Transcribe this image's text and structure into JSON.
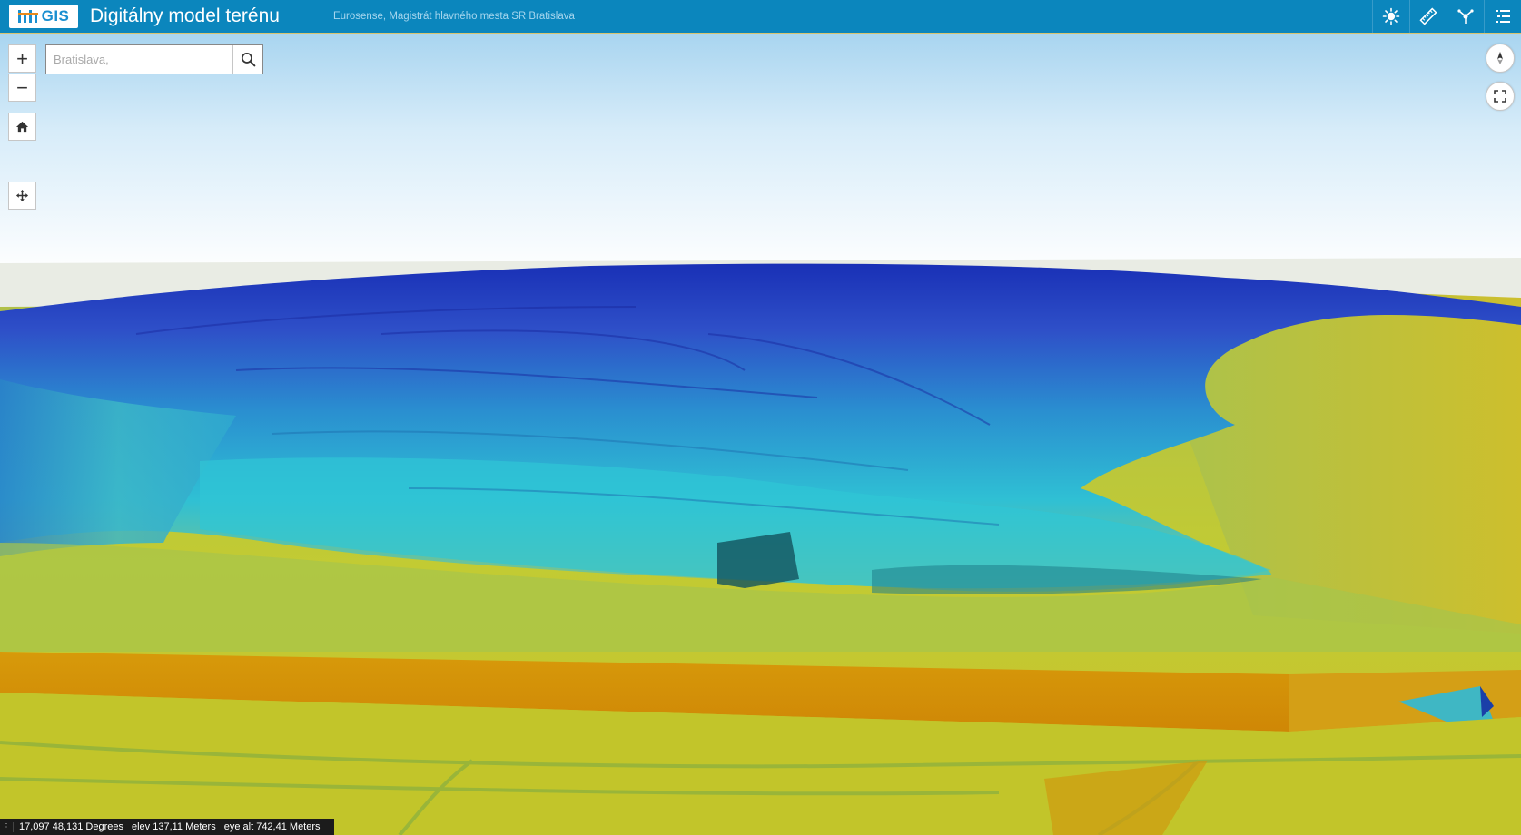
{
  "header": {
    "logo_text": "GIS",
    "title": "Digitálny model terénu",
    "credits": "Eurosense, Magistrát hlavného mesta SR Bratislava",
    "tools": [
      {
        "name": "daylight",
        "icon": "sun-icon"
      },
      {
        "name": "measure",
        "icon": "ruler-icon"
      },
      {
        "name": "line-of-sight",
        "icon": "line-of-sight-icon"
      },
      {
        "name": "layer-list",
        "icon": "layer-list-icon"
      }
    ]
  },
  "search": {
    "placeholder": "Bratislava,",
    "value": ""
  },
  "controls": {
    "zoom_in": "+",
    "zoom_out": "−",
    "home_icon": "home-icon",
    "navigation_icon": "pan-arrows-icon",
    "compass_icon": "compass-icon",
    "fullscreen_icon": "fullscreen-icon"
  },
  "status": {
    "coordinates": "17,097 48,131 Degrees",
    "elevation": "elev 137,11 Meters",
    "eye_altitude": "eye alt 742,41 Meters"
  },
  "colors": {
    "header": "#0b86bd",
    "terrain_high": "#1d2fb8",
    "terrain_mid": "#2cc2d2",
    "terrain_low": "#c9cf2a",
    "terrain_river": "#d99208"
  }
}
